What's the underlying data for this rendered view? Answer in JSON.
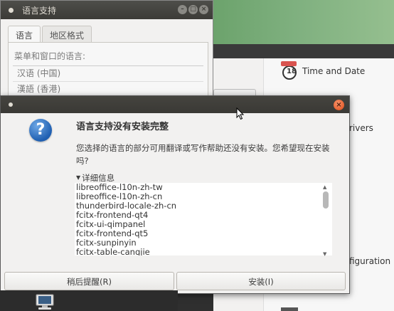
{
  "language_window": {
    "title": "语言支持",
    "tabs": [
      "语言",
      "地区格式"
    ],
    "caption": "菜单和窗口的语言:",
    "languages": [
      "汉语 (中国)",
      "漢語 (香港)"
    ]
  },
  "settings_panel": {
    "items": [
      {
        "label": "Time and Date",
        "icon": "calendar-clock-icon"
      },
      {
        "label": "rivers",
        "icon": ""
      },
      {
        "label": "figuration",
        "icon": ""
      }
    ]
  },
  "dialog": {
    "heading": "语言支持没有安装完整",
    "message": "您选择的语言的部分可用翻译或写作帮助还没有安装。您希望现在安装吗?",
    "details_label": "详细信息",
    "packages": [
      "libreoffice-l10n-zh-tw",
      "libreoffice-l10n-zh-cn",
      "thunderbird-locale-zh-cn",
      "fcitx-frontend-qt4",
      "fcitx-ui-qimpanel",
      "fcitx-frontend-qt5",
      "fcitx-sunpinyin",
      "fcitx-table-cangjie"
    ],
    "remind_later_label": "稍后提醒(R)",
    "install_label": "安装(I)"
  },
  "colors": {
    "titlebar": "#3c3b37",
    "close_button": "#df4a16",
    "question_icon": "#1f5fb1",
    "desktop_green": "#5f9a5f"
  }
}
